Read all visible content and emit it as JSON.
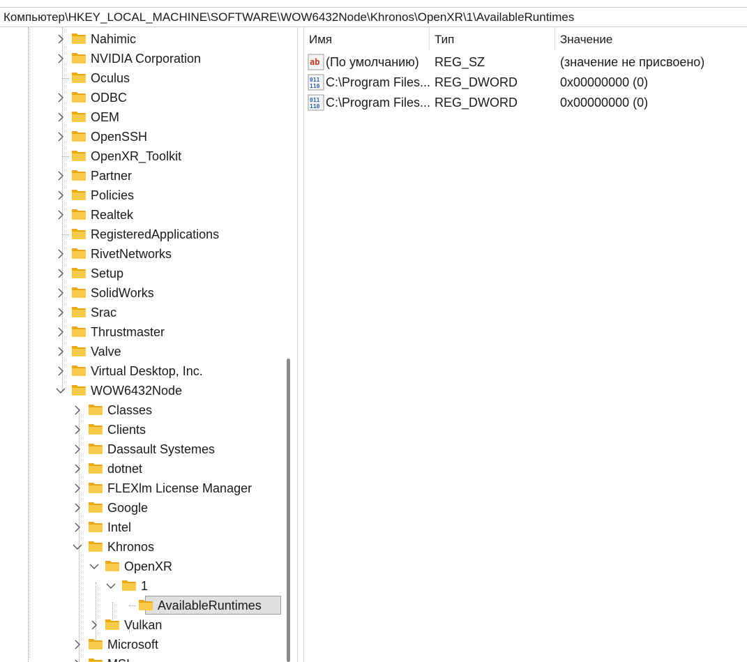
{
  "address": {
    "path": "Компьютер\\HKEY_LOCAL_MACHINE\\SOFTWARE\\WOW6432Node\\Khronos\\OpenXR\\1\\AvailableRuntimes"
  },
  "tree": {
    "nodes": [
      {
        "label": "Nahimic",
        "expander": "collapsed"
      },
      {
        "label": "NVIDIA Corporation",
        "expander": "collapsed"
      },
      {
        "label": "Oculus",
        "expander": "none"
      },
      {
        "label": "ODBC",
        "expander": "collapsed"
      },
      {
        "label": "OEM",
        "expander": "collapsed"
      },
      {
        "label": "OpenSSH",
        "expander": "collapsed"
      },
      {
        "label": "OpenXR_Toolkit",
        "expander": "none"
      },
      {
        "label": "Partner",
        "expander": "collapsed"
      },
      {
        "label": "Policies",
        "expander": "collapsed"
      },
      {
        "label": "Realtek",
        "expander": "collapsed"
      },
      {
        "label": "RegisteredApplications",
        "expander": "none"
      },
      {
        "label": "RivetNetworks",
        "expander": "collapsed"
      },
      {
        "label": "Setup",
        "expander": "collapsed"
      },
      {
        "label": "SolidWorks",
        "expander": "collapsed"
      },
      {
        "label": "Srac",
        "expander": "collapsed"
      },
      {
        "label": "Thrustmaster",
        "expander": "collapsed"
      },
      {
        "label": "Valve",
        "expander": "collapsed"
      },
      {
        "label": "Virtual Desktop, Inc.",
        "expander": "collapsed"
      },
      {
        "label": "WOW6432Node",
        "expander": "expanded"
      },
      {
        "label": "Classes",
        "expander": "collapsed"
      },
      {
        "label": "Clients",
        "expander": "collapsed"
      },
      {
        "label": "Dassault Systemes",
        "expander": "collapsed"
      },
      {
        "label": "dotnet",
        "expander": "collapsed"
      },
      {
        "label": "FLEXlm License Manager",
        "expander": "collapsed"
      },
      {
        "label": "Google",
        "expander": "collapsed"
      },
      {
        "label": "Intel",
        "expander": "collapsed"
      },
      {
        "label": "Khronos",
        "expander": "expanded"
      },
      {
        "label": "OpenXR",
        "expander": "expanded"
      },
      {
        "label": "1",
        "expander": "expanded"
      },
      {
        "label": "AvailableRuntimes",
        "expander": "none",
        "selected": true
      },
      {
        "label": "Vulkan",
        "expander": "collapsed"
      },
      {
        "label": "Microsoft",
        "expander": "collapsed"
      },
      {
        "label": "MSI",
        "expander": "collapsed"
      }
    ]
  },
  "list": {
    "columns": [
      "Имя",
      "Тип",
      "Значение"
    ],
    "rows": [
      {
        "icon": "string-value-icon",
        "name": "(По умолчанию)",
        "type": "REG_SZ",
        "value": "(значение не присвоено)"
      },
      {
        "icon": "binary-value-icon",
        "name": "C:\\Program Files...",
        "type": "REG_DWORD",
        "value": "0x00000000 (0)"
      },
      {
        "icon": "binary-value-icon",
        "name": "C:\\Program Files...",
        "type": "REG_DWORD",
        "value": "0x00000000 (0)"
      }
    ]
  },
  "colors": {
    "folder": "#f7c948",
    "folder_dark": "#e4a914",
    "selection_bg": "#e0e0e0",
    "string_icon": "#c0392b",
    "binary_icon": "#2f5fa8"
  }
}
